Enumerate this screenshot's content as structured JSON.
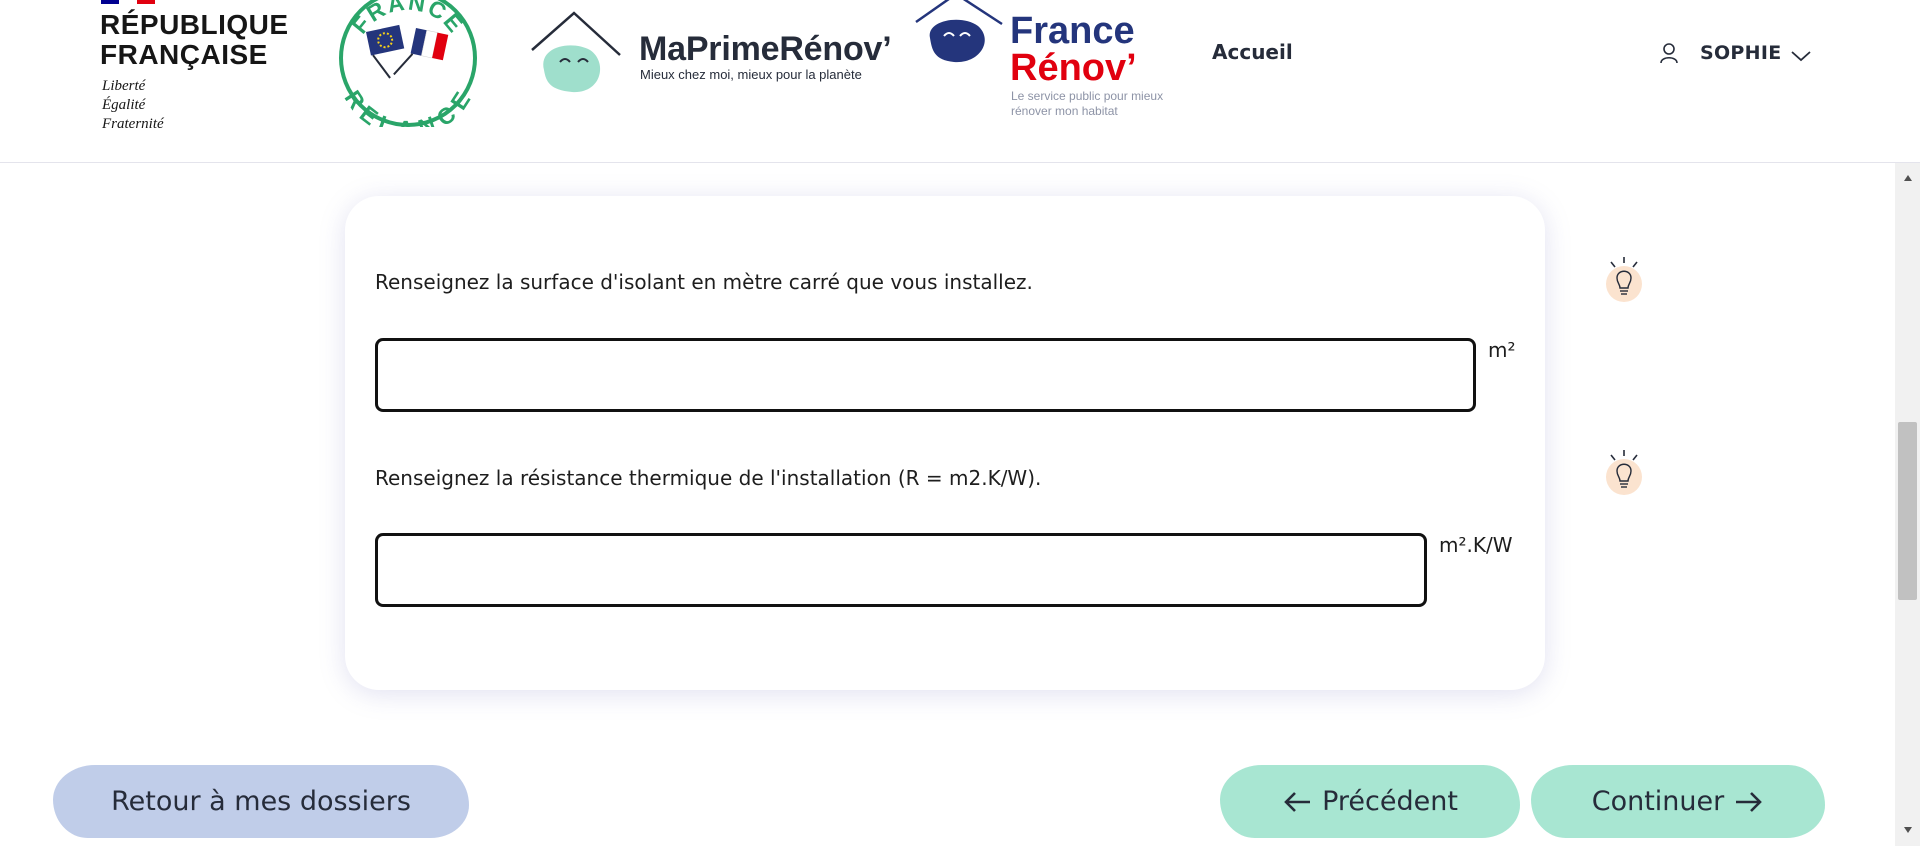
{
  "header": {
    "republique": {
      "title": "RÉPUBLIQUE\nFRANÇAISE",
      "motto": "Liberté\nÉgalité\nFraternité"
    },
    "relance_logo_text": "FRANCE RELANCE",
    "maprimerenov": {
      "title": "MaPrimeRénov’",
      "subtitle": "Mieux chez moi, mieux pour la planète"
    },
    "france_renov": {
      "title_line1": "France",
      "title_line2": "Rénov’",
      "subtitle": "Le service public pour mieux\nrénover mon habitat"
    },
    "nav_home": "Accueil",
    "user_name": "SOPHIE"
  },
  "form": {
    "question1": {
      "label": "Renseignez la surface d'isolant en mètre carré que vous installez.",
      "value": "",
      "unit": "m²"
    },
    "question2": {
      "label": "Renseignez la résistance thermique de l'installation (R = m2.K/W).",
      "value": "",
      "unit": "m².K/W"
    }
  },
  "buttons": {
    "back": "Retour à mes dossiers",
    "previous": "Précédent",
    "continue": "Continuer"
  },
  "colors": {
    "back_button": "#c0cde9",
    "nav_button": "#a8e6d2",
    "brand_blue": "#24357c",
    "brand_red": "#e1000f",
    "relance_green": "#2aa569",
    "hint_bulb_bg": "#fbe3cf"
  },
  "icons": {
    "user": "user-icon",
    "chevron": "chevron-down-icon",
    "hint": "lightbulb-icon",
    "arrow_left": "arrow-left-icon",
    "arrow_right": "arrow-right-icon"
  }
}
